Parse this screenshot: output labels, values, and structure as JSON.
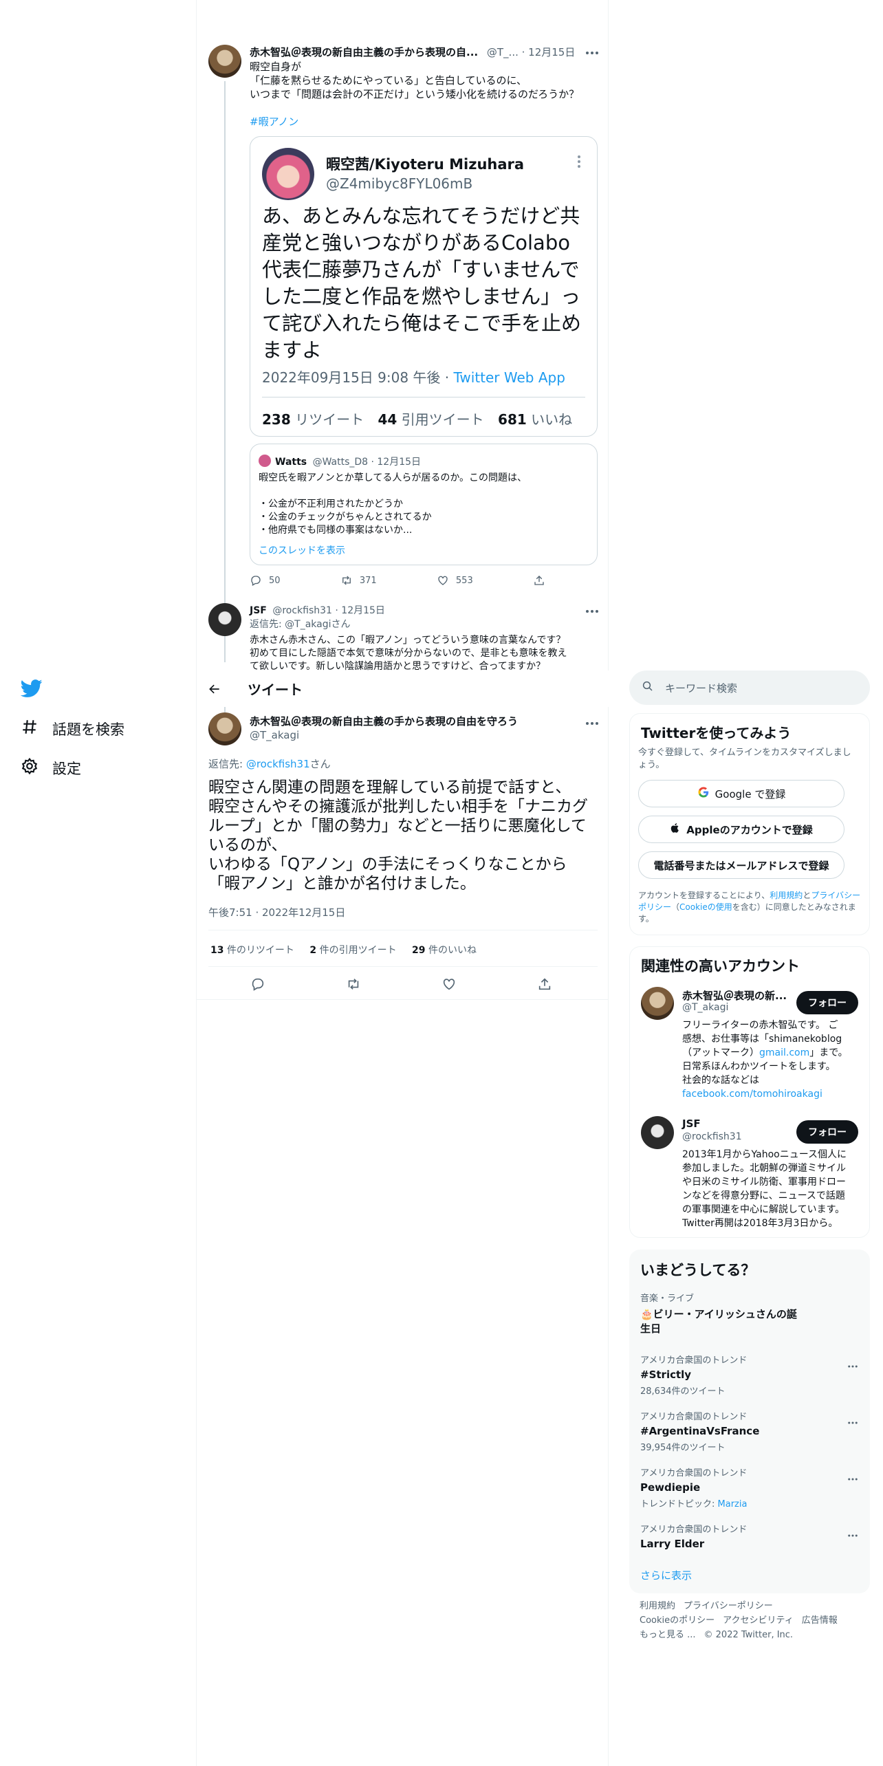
{
  "nav": {
    "explore_label": "話題を検索",
    "settings_label": "設定"
  },
  "header": {
    "title": "ツイート"
  },
  "thread_tweet": {
    "author_name": "赤木智弘＠表現の新自由主義の手から表現の自...",
    "handle_date": "@T_... · 12月15日",
    "line1": "暇空自身が",
    "line2": "「仁藤を黙らせるためにやっている」と告白しているのに、",
    "line3": "いつまで「問題は会計の不正だけ」という矮小化を続けるのだろうか？",
    "hashtag": "#暇アノン",
    "embed": {
      "name": "暇空茜/Kiyoteru Mizuhara",
      "handle": "@Z4mibyc8FYL06mB",
      "text": "あ、あとみんな忘れてそうだけど共産党と強いつながりがあるColabo代表仁藤夢乃さんが「すいませんでした二度と作品を燃やしません」って詫び入れたら俺はそこで手を止めますよ",
      "meta": "2022年09月15日 9:08 午後 · ",
      "via": "Twitter Web App",
      "retweets_num": "238",
      "retweets_label": "リツイート",
      "quotes_num": "44",
      "quotes_label": "引用ツイート",
      "likes_num": "681",
      "likes_label": "いいね"
    },
    "quote": {
      "name": "Watts",
      "handle_date": "@Watts_D8 · 12月15日",
      "line1": "暇空氏を暇アノンとか草してる人らが居るのか。この問題は、",
      "line2": "・公金が不正利用されたかどうか",
      "line3": "・公金のチェックがちゃんとされてるか",
      "line4": "・他府県でも同様の事案はないか...",
      "show_thread": "このスレッドを表示"
    },
    "replies": "50",
    "retweets": "371",
    "likes": "553"
  },
  "reply_tweet": {
    "author_name": "JSF",
    "handle_date": "@rockfish31 · 12月15日",
    "reply_to": "返信先: @T_akagiさん",
    "line1": "赤木さん赤木さん、この「暇アノン」ってどういう意味の言葉なんです？",
    "line2": "初めて目にした隠語で本気で意味が分からないので、是非とも意味を教え",
    "line3": "て欲しいです。新しい陰謀論用語かと思うですけど、合ってますか？"
  },
  "main_tweet": {
    "author_name": "赤木智弘＠表現の新自由主義の手から表現の自由を守ろう",
    "handle": "@T_akagi",
    "reply_prefix": "返信先: ",
    "reply_handle": "@rockfish31",
    "reply_suffix": "さん",
    "line1": "暇空さん関連の問題を理解している前提で話すと、",
    "line2": "暇空さんやその擁護派が批判したい相手を「ナニカグ",
    "line3": "ループ」とか「闇の勢力」などと一括りに悪魔化して",
    "line4": "いるのが、",
    "line5": "いわゆる「Qアノン」の手法にそっくりなことから",
    "line6": "「暇アノン」と誰かが名付けました。",
    "timestamp": "午後7:51 · 2022年12月15日",
    "retweets_num": "13",
    "retweets_label": "件のリツイート",
    "quotes_num": "2",
    "quotes_label": "件の引用ツイート",
    "likes_num": "29",
    "likes_label": "件のいいね"
  },
  "search": {
    "placeholder": "キーワード検索"
  },
  "signup": {
    "title": "Twitterを使ってみよう",
    "subtitle": "今すぐ登録して、タイムラインをカスタマイズしましょう。",
    "google": "Google で登録",
    "apple": "Appleのアカウントで登録",
    "phone": "電話番号またはメールアドレスで登録",
    "legal1": "アカウントを登録することにより、",
    "legal_terms": "利用規約",
    "legal2": "と",
    "legal_privacy": "プライバシーポリシー",
    "legal3": "（",
    "legal_cookie": "Cookieの使用",
    "legal4": "を含む）に同意したとみなされます。"
  },
  "related": {
    "title": "関連性の高いアカウント",
    "accounts": [
      {
        "name": "赤木智弘＠表現の新...",
        "handle": "@T_akagi",
        "follow": "フォロー",
        "bio1": "フリーライターの赤木智弘です。 ご",
        "bio2": "感想、お仕事等は「shimanekoblog",
        "bio3a": "（アットマーク）",
        "bio3b": "gmail.com",
        "bio3c": "」まで。",
        "bio4": "日常系ほんわかツイートをします。",
        "bio5": "社会的な話などは",
        "bio6": "facebook.com/tomohiroakagi"
      },
      {
        "name": "JSF",
        "handle": "@rockfish31",
        "follow": "フォロー",
        "bio1": "2013年1月からYahooニュース個人に",
        "bio2": "参加しました。北朝鮮の弾道ミサイル",
        "bio3": "や日米のミサイル防衛、軍事用ドロー",
        "bio4": "ンなどを得意分野に、ニュースで話題",
        "bio5": "の軍事関連を中心に解説しています。",
        "bio6": "Twitter再開は2018年3月3日から。"
      }
    ]
  },
  "trends": {
    "title": "いまどうしてる？",
    "items": [
      {
        "category": "音楽・ライブ",
        "name1": "🎂ビリー・アイリッシュさんの誕",
        "name2": "生日"
      },
      {
        "category": "アメリカ合衆国のトレンド",
        "name": "#Strictly",
        "count": "28,634件のツイート"
      },
      {
        "category": "アメリカ合衆国のトレンド",
        "name": "#ArgentinaVsFrance",
        "count": "39,954件のツイート"
      },
      {
        "category": "アメリカ合衆国のトレンド",
        "name": "Pewdiepie",
        "topic_label": "トレンドトピック: ",
        "topic": "Marzia"
      },
      {
        "category": "アメリカ合衆国のトレンド",
        "name": "Larry Elder"
      }
    ],
    "show_more": "さらに表示"
  },
  "footer": {
    "terms": "利用規約",
    "privacy": "プライバシーポリシー",
    "cookie": "Cookieのポリシー",
    "accessibility": "アクセシビリティ",
    "ads": "広告情報",
    "more": "もっと見る ...",
    "copyright": "© 2022 Twitter, Inc."
  }
}
